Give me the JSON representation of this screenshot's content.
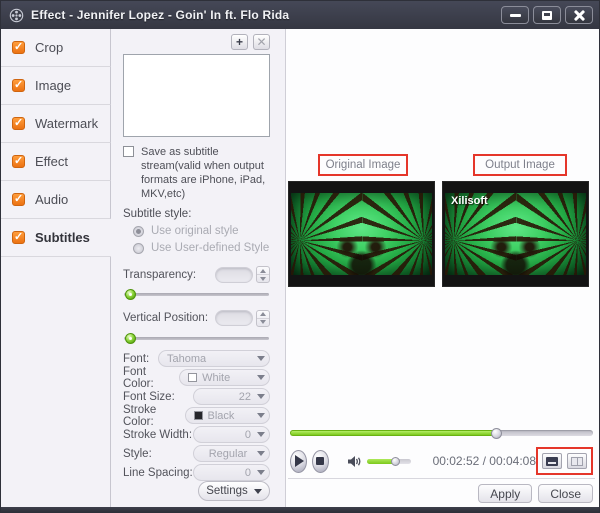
{
  "window": {
    "title": "Effect - Jennifer Lopez - Goin' In ft. Flo Rida"
  },
  "sidebar": {
    "items": [
      {
        "label": "Crop",
        "checked": true,
        "selected": false
      },
      {
        "label": "Image",
        "checked": true,
        "selected": false
      },
      {
        "label": "Watermark",
        "checked": true,
        "selected": false
      },
      {
        "label": "Effect",
        "checked": true,
        "selected": false
      },
      {
        "label": "Audio",
        "checked": true,
        "selected": false
      },
      {
        "label": "Subtitles",
        "checked": true,
        "selected": true
      }
    ]
  },
  "panel": {
    "add_label": "+",
    "remove_label": "✕",
    "save_checkbox_label": "Save as subtitle stream(valid when output formats are iPhone, iPad, MKV,etc)",
    "style_label": "Subtitle style:",
    "radios": [
      {
        "label": "Use original style",
        "selected": true
      },
      {
        "label": "Use User-defined Style",
        "selected": false
      }
    ],
    "transparency_label": "Transparency:",
    "vertical_label": "Vertical Position:",
    "fields": [
      {
        "label": "Font:",
        "value": "Tahoma"
      },
      {
        "label": "Font Color:",
        "value": "White",
        "swatch_style": "background:#ffffff"
      },
      {
        "label": "Font Size:",
        "value": "22"
      },
      {
        "label": "Stroke Color:",
        "value": "Black",
        "swatch_style": "background:#26262b"
      },
      {
        "label": "Stroke Width:",
        "value": "0"
      },
      {
        "label": "Style:",
        "value": "Regular"
      },
      {
        "label": "Line Spacing:",
        "value": "0"
      }
    ],
    "settings_label": "Settings"
  },
  "preview": {
    "original_label": "Original Image",
    "output_label": "Output Image",
    "watermark": "Xilisoft",
    "time": "00:02:52 / 00:04:08"
  },
  "transport": {
    "seek_percent": 68,
    "volume_percent": 64,
    "seek_fill_style": "width:68%",
    "volume_fill_style": "width:64%"
  },
  "footer": {
    "apply_label": "Apply",
    "close_label": "Close"
  },
  "colors": {
    "titlebar": "#3a3d49",
    "accent_orange": "#ee7a17",
    "slider_green": "#8ed63c",
    "annotation_red": "#e5362a"
  }
}
